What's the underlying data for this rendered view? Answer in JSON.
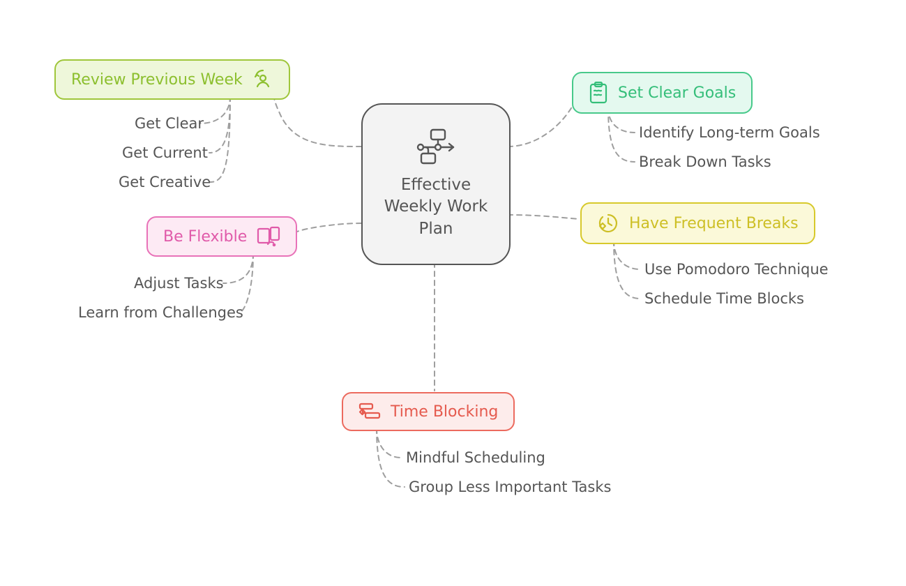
{
  "center": {
    "title": "Effective Weekly Work Plan"
  },
  "branches": {
    "review": {
      "label": "Review Previous Week",
      "items": [
        "Get Clear",
        "Get Current",
        "Get Creative"
      ]
    },
    "flexible": {
      "label": "Be Flexible",
      "items": [
        "Adjust Tasks",
        "Learn from Challenges"
      ]
    },
    "goals": {
      "label": "Set Clear Goals",
      "items": [
        "Identify Long-term Goals",
        "Break Down Tasks"
      ]
    },
    "breaks": {
      "label": "Have Frequent Breaks",
      "items": [
        "Use Pomodoro Technique",
        "Schedule Time Blocks"
      ]
    },
    "blocking": {
      "label": "Time Blocking",
      "items": [
        "Mindful Scheduling",
        "Group Less Important Tasks"
      ]
    }
  },
  "colors": {
    "green": "#9fc63b",
    "teal": "#47c98a",
    "pink": "#e872b8",
    "yellow": "#d7c92b",
    "red": "#ec6a5e",
    "text": "#555"
  }
}
